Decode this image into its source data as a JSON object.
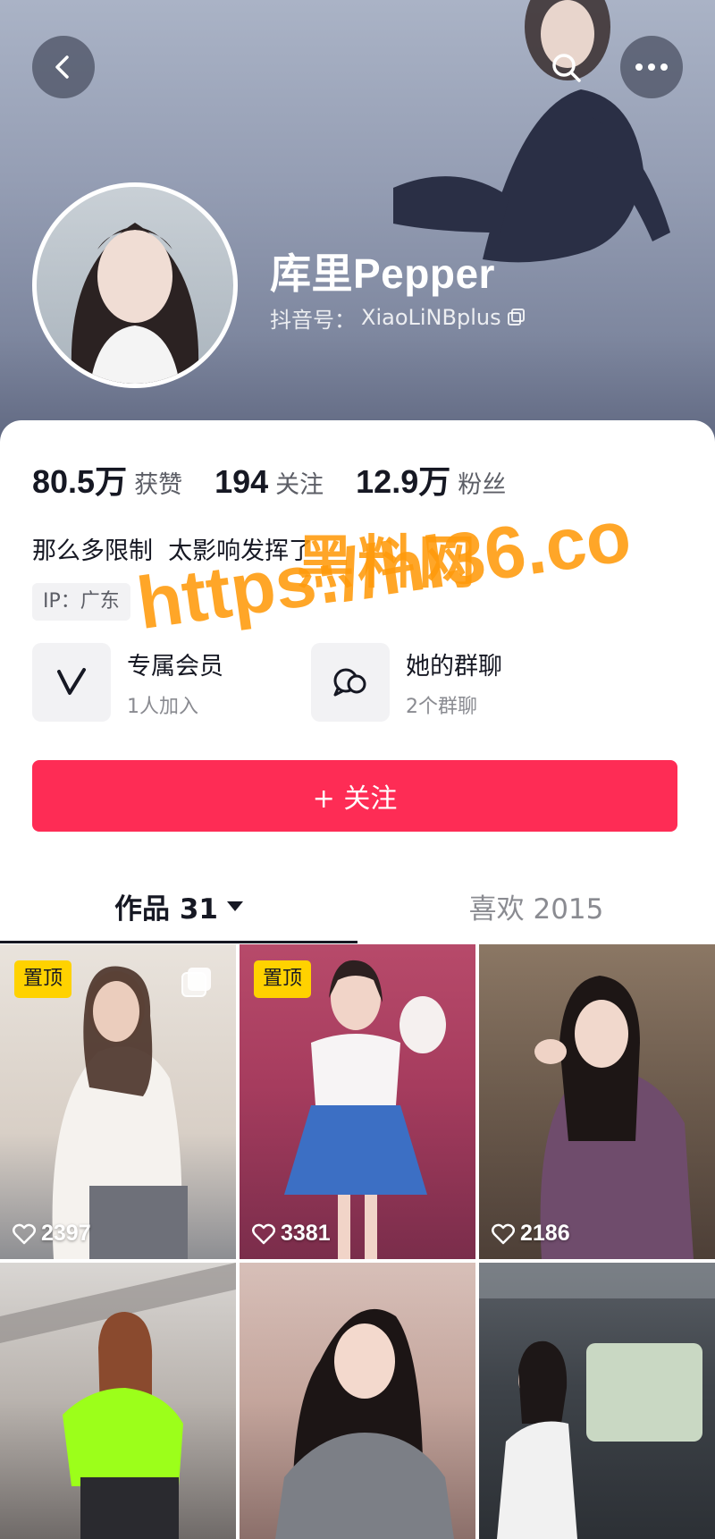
{
  "header": {
    "username": "库里Pepper",
    "douyin_id_label": "抖音号：",
    "douyin_id": "XiaoLiNBplus"
  },
  "stats": [
    {
      "value": "80.5万",
      "label": "获赞"
    },
    {
      "value": "194",
      "label": "关注"
    },
    {
      "value": "12.9万",
      "label": "粉丝"
    }
  ],
  "bio": "那么多限制  太影响发挥了",
  "ip_tag": "IP：广东",
  "features": {
    "vip": {
      "title": "专属会员",
      "sub": "1人加入"
    },
    "group": {
      "title": "她的群聊",
      "sub": "2个群聊"
    }
  },
  "follow_button": "+ 关注",
  "tabs": {
    "works": "作品 31",
    "likes": "喜欢 2015"
  },
  "videos": [
    {
      "pinned": true,
      "pin_label": "置顶",
      "multi_image": true,
      "likes": "2397"
    },
    {
      "pinned": true,
      "pin_label": "置顶",
      "multi_image": false,
      "likes": "3381"
    },
    {
      "pinned": false,
      "likes": "2186"
    },
    {
      "pinned": false
    },
    {
      "pinned": false
    },
    {
      "pinned": false
    }
  ],
  "watermark": {
    "title": "黑料网",
    "url": "https://hl36.co"
  },
  "colors": {
    "accent": "#fe2c55",
    "pin_badge": "#ffd200",
    "watermark": "#ff9a0a"
  },
  "icons": {
    "back": "chevron-left-icon",
    "search": "search-icon",
    "more": "more-dots-icon",
    "copy": "copy-icon",
    "vip": "v-logo-icon",
    "group": "chat-bubbles-icon",
    "heart": "heart-icon",
    "multi": "multi-image-icon",
    "caret": "caret-down-icon"
  }
}
